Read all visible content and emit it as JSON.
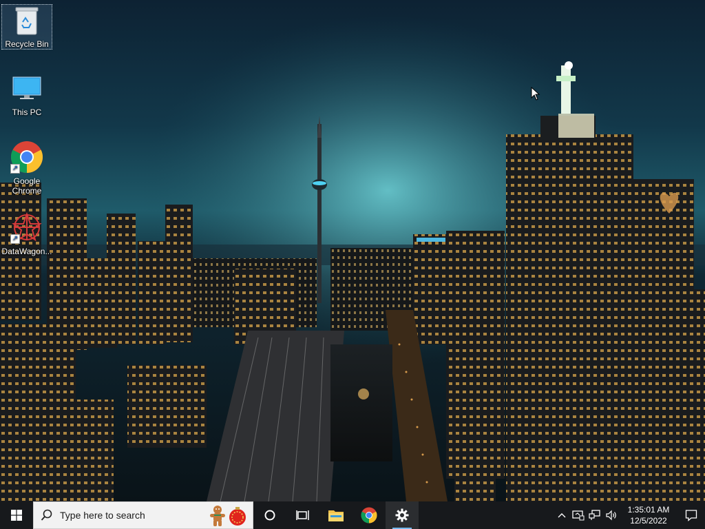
{
  "desktop": {
    "icons": [
      {
        "label": "Recycle Bin",
        "icon": "recycle-bin-icon"
      },
      {
        "label": "This PC",
        "icon": "monitor-icon"
      },
      {
        "label": "Google Chrome",
        "icon": "chrome-icon"
      },
      {
        "label": "DataWagon...",
        "icon": "datawagon-icon"
      }
    ]
  },
  "taskbar": {
    "search_placeholder": "Type here to search",
    "pinned": [
      "cortana-icon",
      "task-view-icon",
      "file-explorer-icon",
      "chrome-icon",
      "settings-icon"
    ],
    "clock": {
      "time": "1:35:01 AM",
      "date": "12/5/2022"
    }
  },
  "colors": {
    "taskbar": "#17191c",
    "active_indicator": "#76b9ed",
    "search_bg": "#f2f2f2"
  }
}
